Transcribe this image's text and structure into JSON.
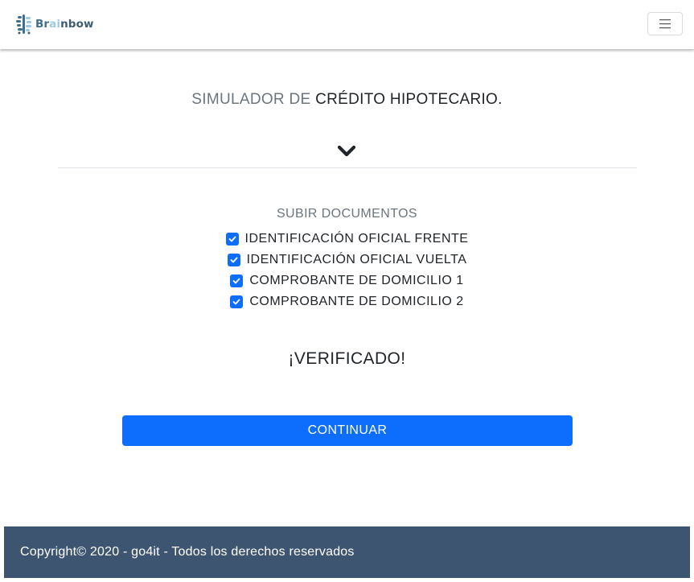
{
  "header": {
    "logo": {
      "icon": "brain-icon",
      "text_a": "Br",
      "text_b": "ai",
      "text_c": "nbow",
      "colors": {
        "primary": "#3f6f8c",
        "accent": "#9ec9df"
      }
    },
    "menu_icon": "hamburger-icon"
  },
  "main": {
    "title_muted": "SIMULADOR DE ",
    "title_dark": "CRÉDITO HIPOTECARIO.",
    "expand_icon": "chevron-down-icon",
    "docs": {
      "heading": "SUBIR DOCUMENTOS",
      "items": [
        {
          "label": "IDENTIFICACIÓN OFICIAL FRENTE",
          "checked": true
        },
        {
          "label": "IDENTIFICACIÓN OFICIAL VUELTA",
          "checked": true
        },
        {
          "label": "COMPROBANTE DE DOMICILIO 1",
          "checked": true
        },
        {
          "label": "COMPROBANTE DE DOMICILIO 2",
          "checked": true
        }
      ]
    },
    "status": "¡VERIFICADO!",
    "continue_label": "CONTINUAR"
  },
  "footer": {
    "text": "Copyright© 2020 - go4it - Todos los derechos reservados"
  },
  "colors": {
    "primary_button": "#0d6efd",
    "footer_bg": "#3d5570",
    "muted_text": "#6c757d"
  }
}
